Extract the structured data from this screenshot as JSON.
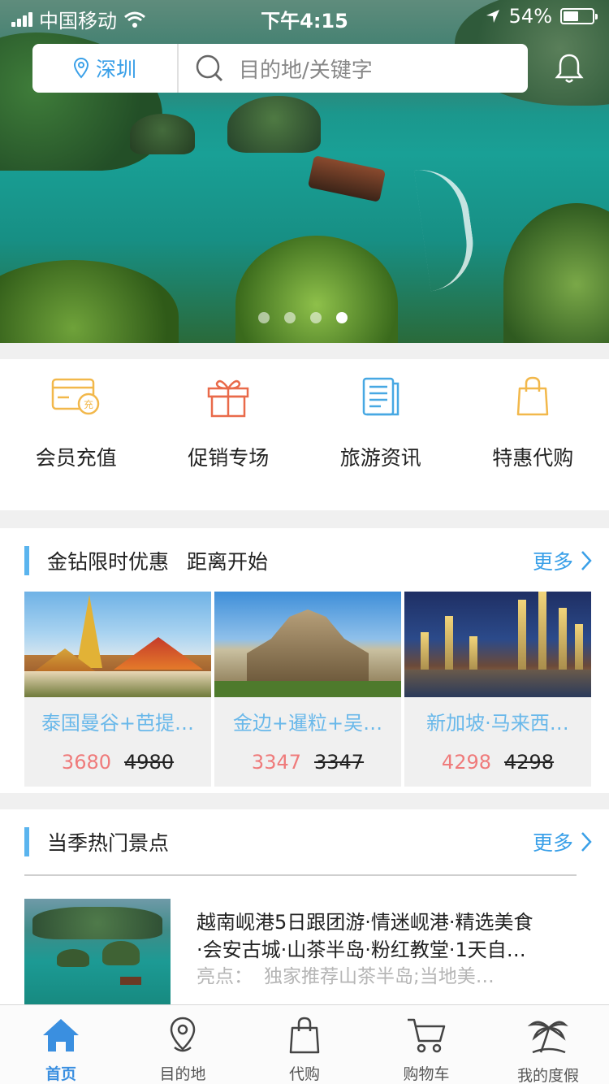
{
  "status_bar": {
    "carrier": "中国移动",
    "time": "下午4:15",
    "battery": "54%",
    "battery_level": 0.54
  },
  "search": {
    "city": "深圳",
    "placeholder": "目的地/关键字"
  },
  "carousel": {
    "total": 4,
    "active": 4
  },
  "quick_menu": [
    {
      "label": "会员充值",
      "icon": "member-card-icon",
      "color": "#f2b84b"
    },
    {
      "label": "促销专场",
      "icon": "gift-icon",
      "color": "#e96a4a"
    },
    {
      "label": "旅游资讯",
      "icon": "news-icon",
      "color": "#47a8e3"
    },
    {
      "label": "特惠代购",
      "icon": "shopping-bag-icon",
      "color": "#f2b84b"
    }
  ],
  "flash_sale": {
    "title": "金钻限时优惠",
    "subtitle": "距离开始",
    "more": "更多",
    "items": [
      {
        "name": "泰国曼谷+芭提…",
        "price": "3680",
        "original": "4980"
      },
      {
        "name": "金边+暹粒+吴…",
        "price": "3347",
        "original": "3347"
      },
      {
        "name": "新加坡·马来西…",
        "price": "4298",
        "original": "4298"
      }
    ]
  },
  "hot_spots": {
    "title": "当季热门景点",
    "more": "更多",
    "item": {
      "title_line1": "越南岘港5日跟团游·情迷岘港·精选美食",
      "title_line2": "·会安古城·山茶半岛·粉红教堂·1天自…",
      "highlight_label": "亮点：",
      "highlight_text": "独家推荐山茶半岛;当地美…"
    }
  },
  "tab_bar": [
    {
      "label": "首页",
      "icon": "home-icon",
      "active": true
    },
    {
      "label": "目的地",
      "icon": "location-pin-icon",
      "active": false
    },
    {
      "label": "代购",
      "icon": "shopping-bag-icon",
      "active": false
    },
    {
      "label": "购物车",
      "icon": "cart-icon",
      "active": false
    },
    {
      "label": "我的度假",
      "icon": "palm-tree-icon",
      "active": false
    }
  ],
  "colors": {
    "accent": "#3a9fe8",
    "price": "#ef7b7b",
    "card_title": "#69b8ea",
    "tab_active": "#3a8fe0"
  }
}
